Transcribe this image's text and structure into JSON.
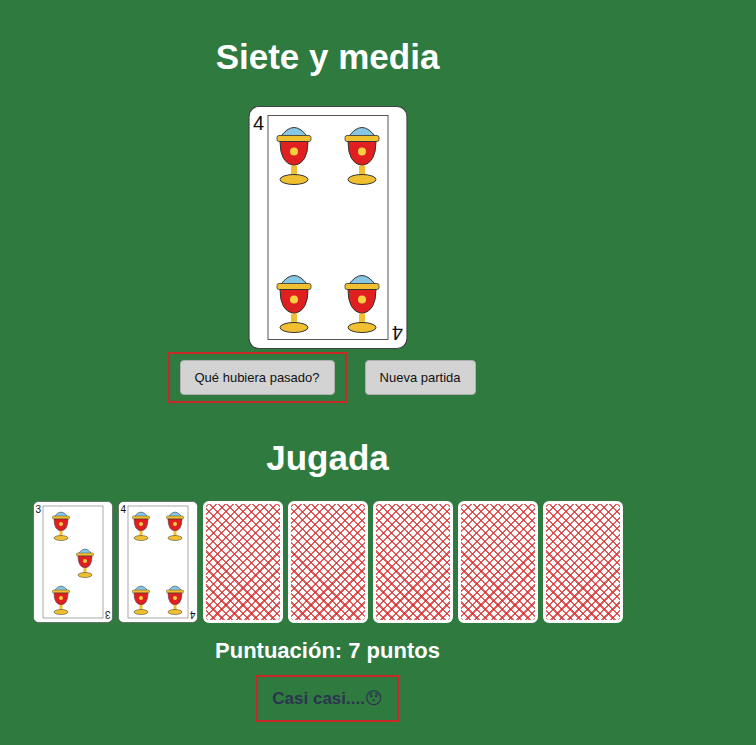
{
  "title": "Siete y media",
  "current_card": {
    "value": "4"
  },
  "actions": [
    {
      "label": "Qué hubiera pasado?",
      "highlighted": true
    },
    {
      "label": "Nueva partida",
      "highlighted": false
    }
  ],
  "hand": {
    "title": "Jugada",
    "cards": [
      {
        "kind": "face",
        "value": "3"
      },
      {
        "kind": "face",
        "value": "4"
      },
      {
        "kind": "back"
      },
      {
        "kind": "back"
      },
      {
        "kind": "back"
      },
      {
        "kind": "back"
      },
      {
        "kind": "back"
      }
    ],
    "score": "Puntuación: 7 puntos",
    "message": {
      "text": "Casi casi....😯",
      "highlighted": true
    }
  }
}
